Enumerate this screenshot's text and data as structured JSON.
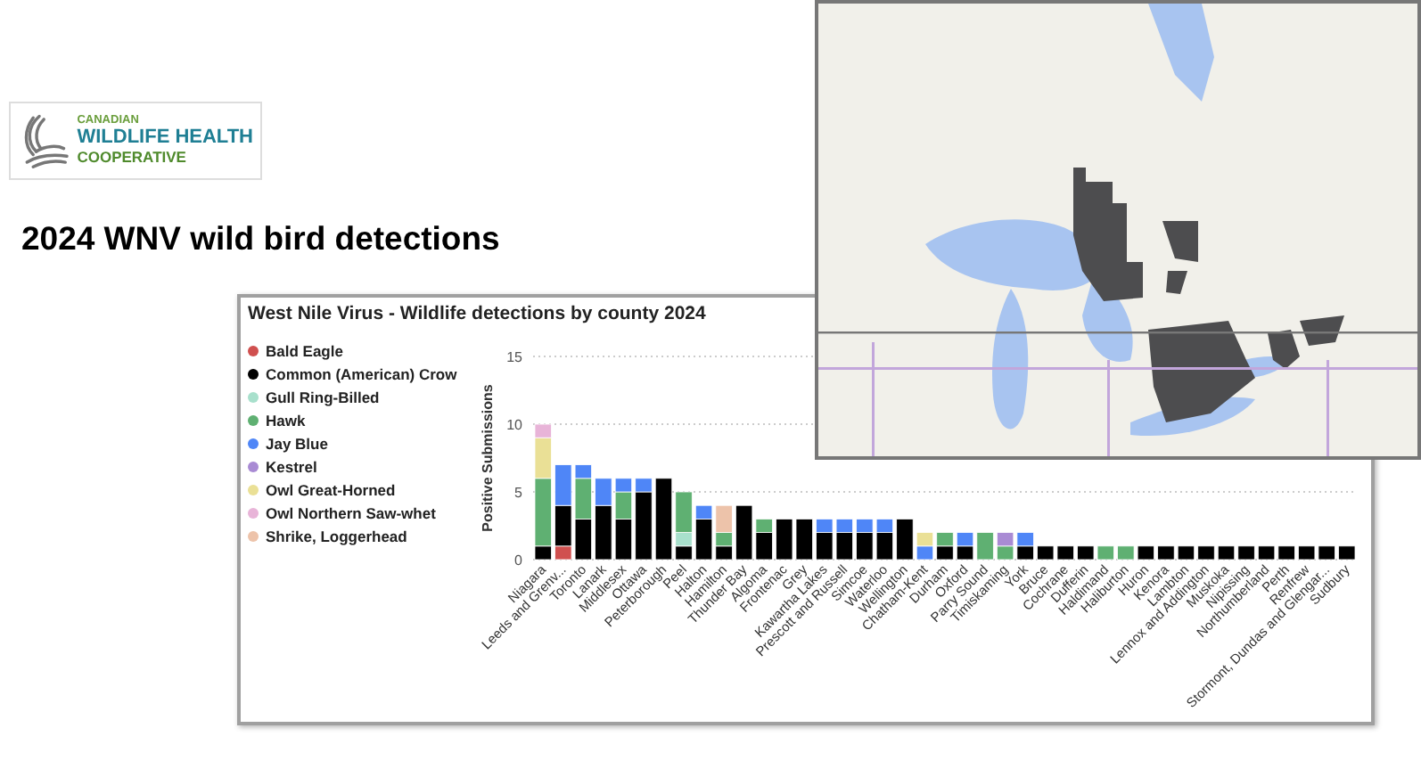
{
  "logo": {
    "lines": [
      "CANADIAN",
      "WILDLIFE HEALTH",
      "COOPERATIVE"
    ]
  },
  "heading": "2024 WNV wild bird detections",
  "chart": {
    "chart_data": {
      "type": "bar",
      "stacked": true,
      "title": "West Nile Virus - Wildlife detections by county 2024",
      "ylabel": "Positive Submissions",
      "ylim": [
        0,
        15
      ],
      "yticks": [
        0,
        5,
        10,
        15
      ],
      "categories": [
        "Niagara",
        "Leeds and Grenv...",
        "Toronto",
        "Lanark",
        "Middlesex",
        "Ottawa",
        "Peterborough",
        "Peel",
        "Halton",
        "Hamilton",
        "Thunder Bay",
        "Algoma",
        "Frontenac",
        "Grey",
        "Kawartha Lakes",
        "Prescott and Russell",
        "Simcoe",
        "Waterloo",
        "Wellington",
        "Chatham-Kent",
        "Durham",
        "Oxford",
        "Parry Sound",
        "Timiskaming",
        "York",
        "Bruce",
        "Cochrane",
        "Dufferin",
        "Haldimand",
        "Haliburton",
        "Huron",
        "Kenora",
        "Lambton",
        "Lennox and Addington",
        "Muskoka",
        "Nipissing",
        "Northumberland",
        "Perth",
        "Renfrew",
        "Stormont, Dundas and Glengar...",
        "Sudbury"
      ],
      "series": [
        {
          "name": "Bald Eagle",
          "color": "#d0504f",
          "values": [
            0,
            1,
            0,
            0,
            0,
            0,
            0,
            0,
            0,
            0,
            0,
            0,
            0,
            0,
            0,
            0,
            0,
            0,
            0,
            0,
            0,
            0,
            0,
            0,
            0,
            0,
            0,
            0,
            0,
            0,
            0,
            0,
            0,
            0,
            0,
            0,
            0,
            0,
            0,
            0,
            0
          ]
        },
        {
          "name": "Common (American) Crow",
          "color": "#000000",
          "values": [
            1,
            3,
            3,
            4,
            3,
            5,
            6,
            1,
            3,
            1,
            4,
            2,
            3,
            3,
            2,
            2,
            2,
            2,
            3,
            0,
            1,
            1,
            0,
            0,
            1,
            1,
            1,
            1,
            0,
            0,
            1,
            1,
            1,
            1,
            1,
            1,
            1,
            1,
            1,
            1,
            1
          ]
        },
        {
          "name": "Gull Ring-Billed",
          "color": "#a8e0cc",
          "values": [
            0,
            0,
            0,
            0,
            0,
            0,
            0,
            1,
            0,
            0,
            0,
            0,
            0,
            0,
            0,
            0,
            0,
            0,
            0,
            0,
            0,
            0,
            0,
            0,
            0,
            0,
            0,
            0,
            0,
            0,
            0,
            0,
            0,
            0,
            0,
            0,
            0,
            0,
            0,
            0,
            0
          ]
        },
        {
          "name": "Hawk",
          "color": "#5fb072",
          "values": [
            5,
            0,
            3,
            0,
            2,
            0,
            0,
            3,
            0,
            1,
            0,
            1,
            0,
            0,
            0,
            0,
            0,
            0,
            0,
            0,
            1,
            0,
            2,
            1,
            0,
            0,
            0,
            0,
            1,
            1,
            0,
            0,
            0,
            0,
            0,
            0,
            0,
            0,
            0,
            0,
            0
          ]
        },
        {
          "name": "Jay Blue",
          "color": "#4f86f7",
          "values": [
            0,
            3,
            1,
            2,
            1,
            1,
            0,
            0,
            1,
            0,
            0,
            0,
            0,
            0,
            1,
            1,
            1,
            1,
            0,
            1,
            0,
            1,
            0,
            0,
            1,
            0,
            0,
            0,
            0,
            0,
            0,
            0,
            0,
            0,
            0,
            0,
            0,
            0,
            0,
            0,
            0
          ]
        },
        {
          "name": "Kestrel",
          "color": "#a98bd4",
          "values": [
            0,
            0,
            0,
            0,
            0,
            0,
            0,
            0,
            0,
            0,
            0,
            0,
            0,
            0,
            0,
            0,
            0,
            0,
            0,
            0,
            0,
            0,
            0,
            1,
            0,
            0,
            0,
            0,
            0,
            0,
            0,
            0,
            0,
            0,
            0,
            0,
            0,
            0,
            0,
            0,
            0
          ]
        },
        {
          "name": "Owl Great-Horned",
          "color": "#eae096",
          "values": [
            3,
            0,
            0,
            0,
            0,
            0,
            0,
            0,
            0,
            0,
            0,
            0,
            0,
            0,
            0,
            0,
            0,
            0,
            0,
            1,
            0,
            0,
            0,
            0,
            0,
            0,
            0,
            0,
            0,
            0,
            0,
            0,
            0,
            0,
            0,
            0,
            0,
            0,
            0,
            0,
            0
          ]
        },
        {
          "name": "Owl Northern Saw-whet",
          "color": "#e8b4d8",
          "values": [
            1,
            0,
            0,
            0,
            0,
            0,
            0,
            0,
            0,
            0,
            0,
            0,
            0,
            0,
            0,
            0,
            0,
            0,
            0,
            0,
            0,
            0,
            0,
            0,
            0,
            0,
            0,
            0,
            0,
            0,
            0,
            0,
            0,
            0,
            0,
            0,
            0,
            0,
            0,
            0,
            0
          ]
        },
        {
          "name": "Shrike, Loggerhead",
          "color": "#edc3aa",
          "values": [
            0,
            0,
            0,
            0,
            0,
            0,
            0,
            0,
            0,
            2,
            0,
            0,
            0,
            0,
            0,
            0,
            0,
            0,
            0,
            0,
            0,
            0,
            0,
            0,
            0,
            0,
            0,
            0,
            0,
            0,
            0,
            0,
            0,
            0,
            0,
            0,
            0,
            0,
            0,
            0,
            0
          ]
        }
      ]
    }
  }
}
